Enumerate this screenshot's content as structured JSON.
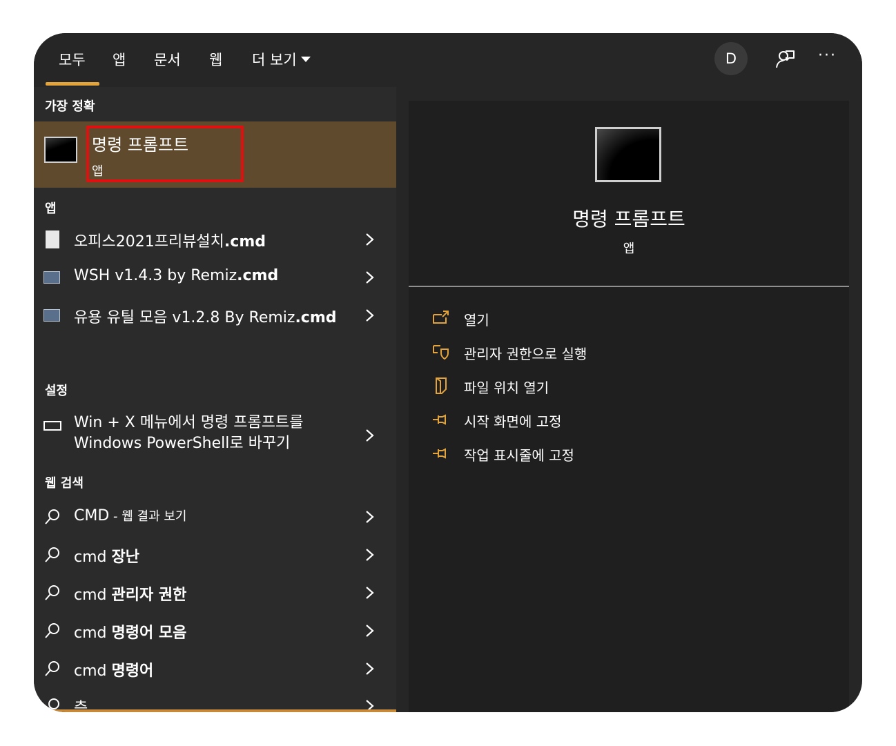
{
  "tabs": [
    {
      "label": "모두"
    },
    {
      "label": "앱"
    },
    {
      "label": "문서"
    },
    {
      "label": "웹"
    },
    {
      "label": "더 보기"
    }
  ],
  "header": {
    "avatar": "D",
    "more": "···"
  },
  "sections": {
    "best": "가장 정확",
    "apps": "앱",
    "settings": "설정",
    "web": "웹 검색"
  },
  "best_match": {
    "title": "명령 프롬프트",
    "subtitle": "앱"
  },
  "apps": [
    {
      "label": "오피스2021프리뷰설치",
      "bold": ".cmd",
      "icon": "document-icon"
    },
    {
      "label": "WSH v1.4.3 by Remiz",
      "bold": ".cmd",
      "icon": "script-icon"
    },
    {
      "label": "유용 유틸 모음 v1.2.8 By Remiz",
      "bold": ".cmd",
      "icon": "script-icon"
    }
  ],
  "settings_item": {
    "line1": "Win + X 메뉴에서 명령 프롬프트를",
    "line2": "Windows PowerShell로 바꾸기"
  },
  "web_results": [
    {
      "prefix": "CMD",
      "bold": "",
      "suffix": " - 웹 결과 보기"
    },
    {
      "prefix": "cmd ",
      "bold": "장난",
      "suffix": ""
    },
    {
      "prefix": "cmd ",
      "bold": "관리자 권한",
      "suffix": ""
    },
    {
      "prefix": "cmd ",
      "bold": "명령어 모음",
      "suffix": ""
    },
    {
      "prefix": "cmd ",
      "bold": "명령어",
      "suffix": ""
    },
    {
      "prefix": "",
      "bold": "",
      "suffix": "층"
    }
  ],
  "preview": {
    "title": "명령 프롬프트",
    "subtitle": "앱"
  },
  "actions": [
    {
      "label": "열기",
      "icon": "open-icon"
    },
    {
      "label": "관리자 권한으로 실행",
      "icon": "shield-icon"
    },
    {
      "label": "파일 위치 열기",
      "icon": "folder-icon"
    },
    {
      "label": "시작 화면에 고정",
      "icon": "pin-icon"
    },
    {
      "label": "작업 표시줄에 고정",
      "icon": "pin-icon"
    }
  ],
  "colors": {
    "accent": "#e3a53b",
    "highlight": "#5f4a2e",
    "focus_box": "#e01010"
  }
}
